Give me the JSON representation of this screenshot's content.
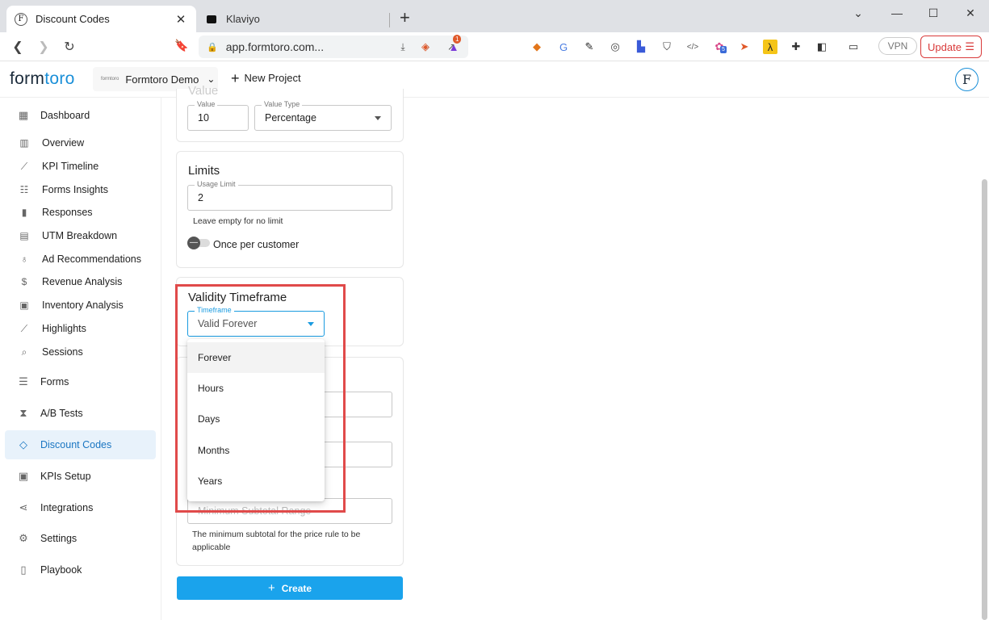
{
  "browser": {
    "tabs": [
      {
        "title": "Discount Codes",
        "close": "✕"
      },
      {
        "title": "Klaviyo",
        "close": "✕"
      }
    ],
    "new_tab": "+",
    "url": "app.formtoro.com...",
    "notification_count": "1",
    "extension_badge": "5",
    "vpn_label": "VPN",
    "update_label": "Update"
  },
  "app": {
    "logo_main": "form",
    "logo_accent": "toro",
    "project_mini": "formtoro",
    "project_name": "Formtoro Demo",
    "new_project": "New Project",
    "avatar_letter": "F"
  },
  "sidebar": {
    "items": [
      {
        "label": "Dashboard",
        "icon": "dashboard-icon"
      },
      {
        "label": "Overview",
        "icon": "bar-chart-icon"
      },
      {
        "label": "KPI Timeline",
        "icon": "trend-icon"
      },
      {
        "label": "Forms Insights",
        "icon": "forms-insights-icon"
      },
      {
        "label": "Responses",
        "icon": "responses-icon"
      },
      {
        "label": "UTM Breakdown",
        "icon": "table-icon"
      },
      {
        "label": "Ad Recommendations",
        "icon": "lightbulb-icon"
      },
      {
        "label": "Revenue Analysis",
        "icon": "dollar-icon"
      },
      {
        "label": "Inventory Analysis",
        "icon": "clipboard-icon"
      },
      {
        "label": "Highlights",
        "icon": "highlights-icon"
      },
      {
        "label": "Sessions",
        "icon": "sessions-icon"
      },
      {
        "label": "Forms",
        "icon": "forms-icon"
      },
      {
        "label": "A/B Tests",
        "icon": "hourglass-icon"
      },
      {
        "label": "Discount Codes",
        "icon": "tag-icon"
      },
      {
        "label": "KPIs Setup",
        "icon": "kpi-icon"
      },
      {
        "label": "Integrations",
        "icon": "share-icon"
      },
      {
        "label": "Settings",
        "icon": "gear-icon"
      },
      {
        "label": "Playbook",
        "icon": "book-icon"
      }
    ],
    "active": "Discount Codes"
  },
  "form": {
    "value_section_title": "Value",
    "value_label": "Value",
    "value": "10",
    "value_type_label": "Value Type",
    "value_type": "Percentage",
    "limits_title": "Limits",
    "usage_limit_label": "Usage Limit",
    "usage_limit": "2",
    "usage_helper": "Leave empty for no limit",
    "once_per_customer": "Once per customer",
    "validity_title": "Validity Timeframe",
    "timeframe_label": "Timeframe",
    "timeframe_value": "Valid Forever",
    "timeframe_options": [
      "Forever",
      "Hours",
      "Days",
      "Months",
      "Years"
    ],
    "min_subtotal_placeholder": "Minimum Subtotal Range",
    "min_subtotal_helper": "The minimum subtotal for the price rule to be applicable",
    "create_label": "Create"
  }
}
